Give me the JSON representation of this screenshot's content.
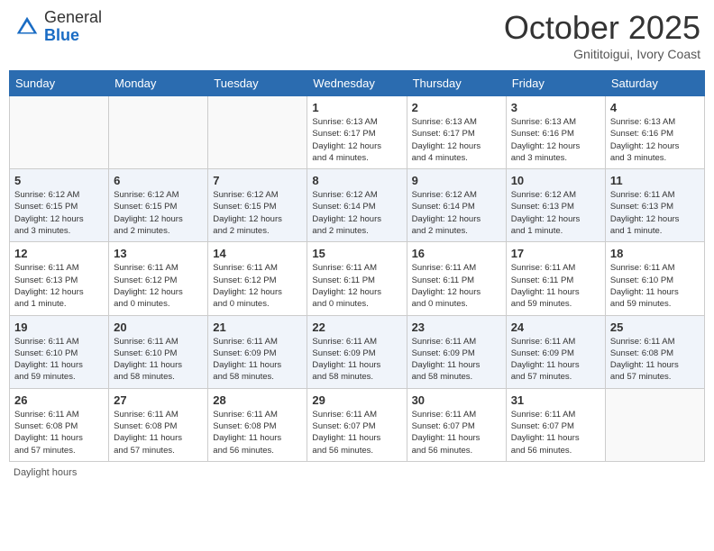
{
  "header": {
    "logo_general": "General",
    "logo_blue": "Blue",
    "month": "October 2025",
    "location": "Gnititoigui, Ivory Coast"
  },
  "days_of_week": [
    "Sunday",
    "Monday",
    "Tuesday",
    "Wednesday",
    "Thursday",
    "Friday",
    "Saturday"
  ],
  "footer_text": "Daylight hours",
  "weeks": [
    {
      "row_class": "row-odd",
      "days": [
        {
          "date": "",
          "info": "",
          "empty": true
        },
        {
          "date": "",
          "info": "",
          "empty": true
        },
        {
          "date": "",
          "info": "",
          "empty": true
        },
        {
          "date": "1",
          "info": "Sunrise: 6:13 AM\nSunset: 6:17 PM\nDaylight: 12 hours\nand 4 minutes."
        },
        {
          "date": "2",
          "info": "Sunrise: 6:13 AM\nSunset: 6:17 PM\nDaylight: 12 hours\nand 4 minutes."
        },
        {
          "date": "3",
          "info": "Sunrise: 6:13 AM\nSunset: 6:16 PM\nDaylight: 12 hours\nand 3 minutes."
        },
        {
          "date": "4",
          "info": "Sunrise: 6:13 AM\nSunset: 6:16 PM\nDaylight: 12 hours\nand 3 minutes."
        }
      ]
    },
    {
      "row_class": "row-even",
      "days": [
        {
          "date": "5",
          "info": "Sunrise: 6:12 AM\nSunset: 6:15 PM\nDaylight: 12 hours\nand 3 minutes."
        },
        {
          "date": "6",
          "info": "Sunrise: 6:12 AM\nSunset: 6:15 PM\nDaylight: 12 hours\nand 2 minutes."
        },
        {
          "date": "7",
          "info": "Sunrise: 6:12 AM\nSunset: 6:15 PM\nDaylight: 12 hours\nand 2 minutes."
        },
        {
          "date": "8",
          "info": "Sunrise: 6:12 AM\nSunset: 6:14 PM\nDaylight: 12 hours\nand 2 minutes."
        },
        {
          "date": "9",
          "info": "Sunrise: 6:12 AM\nSunset: 6:14 PM\nDaylight: 12 hours\nand 2 minutes."
        },
        {
          "date": "10",
          "info": "Sunrise: 6:12 AM\nSunset: 6:13 PM\nDaylight: 12 hours\nand 1 minute."
        },
        {
          "date": "11",
          "info": "Sunrise: 6:11 AM\nSunset: 6:13 PM\nDaylight: 12 hours\nand 1 minute."
        }
      ]
    },
    {
      "row_class": "row-odd",
      "days": [
        {
          "date": "12",
          "info": "Sunrise: 6:11 AM\nSunset: 6:13 PM\nDaylight: 12 hours\nand 1 minute."
        },
        {
          "date": "13",
          "info": "Sunrise: 6:11 AM\nSunset: 6:12 PM\nDaylight: 12 hours\nand 0 minutes."
        },
        {
          "date": "14",
          "info": "Sunrise: 6:11 AM\nSunset: 6:12 PM\nDaylight: 12 hours\nand 0 minutes."
        },
        {
          "date": "15",
          "info": "Sunrise: 6:11 AM\nSunset: 6:11 PM\nDaylight: 12 hours\nand 0 minutes."
        },
        {
          "date": "16",
          "info": "Sunrise: 6:11 AM\nSunset: 6:11 PM\nDaylight: 12 hours\nand 0 minutes."
        },
        {
          "date": "17",
          "info": "Sunrise: 6:11 AM\nSunset: 6:11 PM\nDaylight: 11 hours\nand 59 minutes."
        },
        {
          "date": "18",
          "info": "Sunrise: 6:11 AM\nSunset: 6:10 PM\nDaylight: 11 hours\nand 59 minutes."
        }
      ]
    },
    {
      "row_class": "row-even",
      "days": [
        {
          "date": "19",
          "info": "Sunrise: 6:11 AM\nSunset: 6:10 PM\nDaylight: 11 hours\nand 59 minutes."
        },
        {
          "date": "20",
          "info": "Sunrise: 6:11 AM\nSunset: 6:10 PM\nDaylight: 11 hours\nand 58 minutes."
        },
        {
          "date": "21",
          "info": "Sunrise: 6:11 AM\nSunset: 6:09 PM\nDaylight: 11 hours\nand 58 minutes."
        },
        {
          "date": "22",
          "info": "Sunrise: 6:11 AM\nSunset: 6:09 PM\nDaylight: 11 hours\nand 58 minutes."
        },
        {
          "date": "23",
          "info": "Sunrise: 6:11 AM\nSunset: 6:09 PM\nDaylight: 11 hours\nand 58 minutes."
        },
        {
          "date": "24",
          "info": "Sunrise: 6:11 AM\nSunset: 6:09 PM\nDaylight: 11 hours\nand 57 minutes."
        },
        {
          "date": "25",
          "info": "Sunrise: 6:11 AM\nSunset: 6:08 PM\nDaylight: 11 hours\nand 57 minutes."
        }
      ]
    },
    {
      "row_class": "row-odd",
      "days": [
        {
          "date": "26",
          "info": "Sunrise: 6:11 AM\nSunset: 6:08 PM\nDaylight: 11 hours\nand 57 minutes."
        },
        {
          "date": "27",
          "info": "Sunrise: 6:11 AM\nSunset: 6:08 PM\nDaylight: 11 hours\nand 57 minutes."
        },
        {
          "date": "28",
          "info": "Sunrise: 6:11 AM\nSunset: 6:08 PM\nDaylight: 11 hours\nand 56 minutes."
        },
        {
          "date": "29",
          "info": "Sunrise: 6:11 AM\nSunset: 6:07 PM\nDaylight: 11 hours\nand 56 minutes."
        },
        {
          "date": "30",
          "info": "Sunrise: 6:11 AM\nSunset: 6:07 PM\nDaylight: 11 hours\nand 56 minutes."
        },
        {
          "date": "31",
          "info": "Sunrise: 6:11 AM\nSunset: 6:07 PM\nDaylight: 11 hours\nand 56 minutes."
        },
        {
          "date": "",
          "info": "",
          "empty": true
        }
      ]
    }
  ]
}
